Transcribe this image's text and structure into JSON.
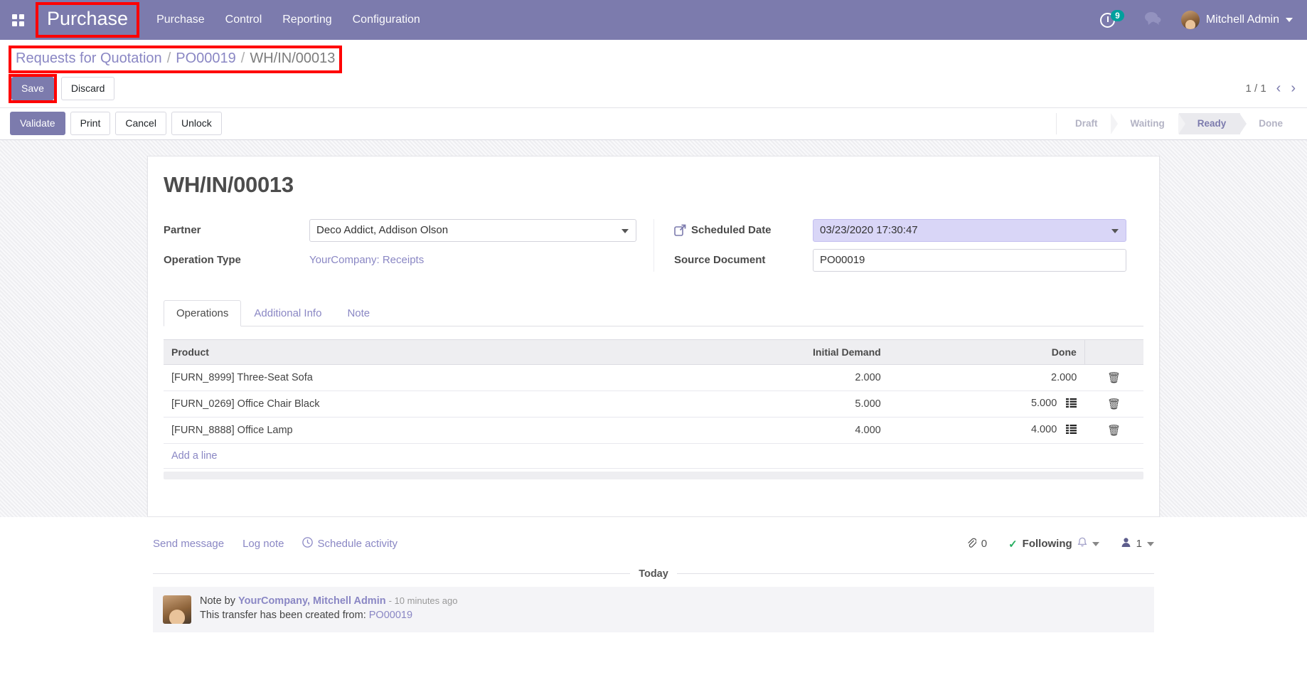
{
  "navbar": {
    "apps_icon": "apps-grid-icon",
    "brand": "Purchase",
    "menu": [
      {
        "label": "Purchase"
      },
      {
        "label": "Control"
      },
      {
        "label": "Reporting"
      },
      {
        "label": "Configuration"
      }
    ],
    "activity_icon": "clock-icon",
    "activity_count": "9",
    "messages_icon": "chat-bubble-icon",
    "user_name": "Mitchell Admin",
    "user_caret_icon": "chevron-down-icon"
  },
  "breadcrumb": {
    "items": [
      {
        "label": "Requests for Quotation",
        "current": false
      },
      {
        "label": "PO00019",
        "current": false
      },
      {
        "label": "WH/IN/00013",
        "current": true
      }
    ],
    "separator": "/"
  },
  "controlpanel": {
    "save_label": "Save",
    "discard_label": "Discard",
    "pager_value": "1 / 1",
    "prev_icon": "chevron-left-icon",
    "next_icon": "chevron-right-icon"
  },
  "actionbar": {
    "buttons": [
      {
        "label": "Validate",
        "primary": true
      },
      {
        "label": "Print",
        "primary": false
      },
      {
        "label": "Cancel",
        "primary": false
      },
      {
        "label": "Unlock",
        "primary": false
      }
    ],
    "statuses": [
      {
        "label": "Draft",
        "active": false
      },
      {
        "label": "Waiting",
        "active": false
      },
      {
        "label": "Ready",
        "active": true
      },
      {
        "label": "Done",
        "active": false
      }
    ]
  },
  "form": {
    "title": "WH/IN/00013",
    "partner_label": "Partner",
    "partner_value": "Deco Addict, Addison Olson",
    "operation_type_label": "Operation Type",
    "operation_type_value": "YourCompany: Receipts",
    "scheduled_date_label": "Scheduled Date",
    "scheduled_date_value": "03/23/2020 17:30:47",
    "scheduled_date_external_icon": "external-link-icon",
    "source_document_label": "Source Document",
    "source_document_value": "PO00019"
  },
  "tabs": [
    {
      "label": "Operations",
      "active": true
    },
    {
      "label": "Additional Info",
      "active": false
    },
    {
      "label": "Note",
      "active": false
    }
  ],
  "lines_table": {
    "columns": [
      "Product",
      "Initial Demand",
      "Done"
    ],
    "rows": [
      {
        "product": "[FURN_8999] Three-Seat Sofa",
        "initial_demand": "2.000",
        "done": "2.000",
        "has_detail_icon": false,
        "detail_icon": "list-detail-icon",
        "delete_icon": "trash-icon"
      },
      {
        "product": "[FURN_0269] Office Chair Black",
        "initial_demand": "5.000",
        "done": "5.000",
        "has_detail_icon": true,
        "detail_icon": "list-detail-icon",
        "delete_icon": "trash-icon"
      },
      {
        "product": "[FURN_8888] Office Lamp",
        "initial_demand": "4.000",
        "done": "4.000",
        "has_detail_icon": true,
        "detail_icon": "list-detail-icon",
        "delete_icon": "trash-icon"
      }
    ],
    "add_line_label": "Add a line"
  },
  "chatter": {
    "send_message": "Send message",
    "log_note": "Log note",
    "schedule_activity": "Schedule activity",
    "schedule_activity_icon": "clock-icon",
    "attachment_icon": "paperclip-icon",
    "attachment_count": "0",
    "following_label": "Following",
    "following_check_icon": "check-icon",
    "bell_icon": "bell-icon",
    "bell_caret_icon": "chevron-down-icon",
    "followers_icon": "user-icon",
    "followers_count": "1",
    "followers_caret_icon": "chevron-down-icon",
    "day_divider": "Today",
    "message": {
      "prefix": "Note by",
      "author": "YourCompany, Mitchell Admin",
      "time": "- 10 minutes ago",
      "body": "This transfer has been created from:",
      "body_link": "PO00019"
    }
  },
  "colors": {
    "brand_purple": "#7C7BAD",
    "annotation_red": "#FF0000",
    "badge_teal": "#00A09D",
    "focus_lavender": "#d9d6f7"
  }
}
